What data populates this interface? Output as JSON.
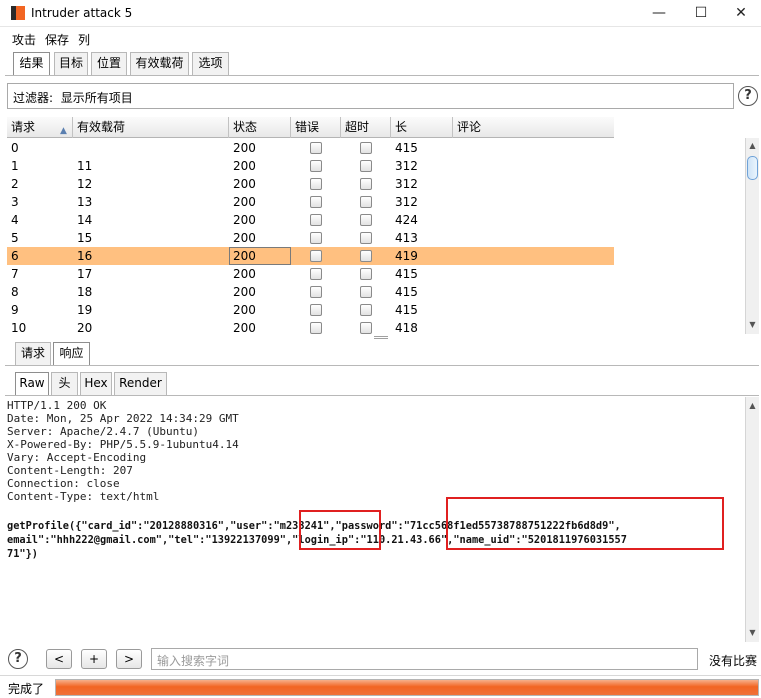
{
  "window": {
    "title": "Intruder attack 5",
    "minimize": "—",
    "maximize": "☐",
    "close": "✕"
  },
  "menu": [
    "攻击",
    "保存",
    "列"
  ],
  "tabs": [
    "结果",
    "目标",
    "位置",
    "有效载荷",
    "选项"
  ],
  "filter": {
    "label": "过滤器:",
    "value": "显示所有项目"
  },
  "help": "?",
  "table": {
    "columns": [
      "请求",
      "有效载荷",
      "状态",
      "错误",
      "超时",
      "长",
      "评论"
    ],
    "sort_indicator": "▲",
    "rows": [
      {
        "request": "0",
        "payload": "",
        "status": "200",
        "error": false,
        "timeout": false,
        "length": "415",
        "comment": ""
      },
      {
        "request": "1",
        "payload": "11",
        "status": "200",
        "error": false,
        "timeout": false,
        "length": "312",
        "comment": ""
      },
      {
        "request": "2",
        "payload": "12",
        "status": "200",
        "error": false,
        "timeout": false,
        "length": "312",
        "comment": ""
      },
      {
        "request": "3",
        "payload": "13",
        "status": "200",
        "error": false,
        "timeout": false,
        "length": "312",
        "comment": ""
      },
      {
        "request": "4",
        "payload": "14",
        "status": "200",
        "error": false,
        "timeout": false,
        "length": "424",
        "comment": ""
      },
      {
        "request": "5",
        "payload": "15",
        "status": "200",
        "error": false,
        "timeout": false,
        "length": "413",
        "comment": ""
      },
      {
        "request": "6",
        "payload": "16",
        "status": "200",
        "error": false,
        "timeout": false,
        "length": "419",
        "comment": ""
      },
      {
        "request": "7",
        "payload": "17",
        "status": "200",
        "error": false,
        "timeout": false,
        "length": "415",
        "comment": ""
      },
      {
        "request": "8",
        "payload": "18",
        "status": "200",
        "error": false,
        "timeout": false,
        "length": "415",
        "comment": ""
      },
      {
        "request": "9",
        "payload": "19",
        "status": "200",
        "error": false,
        "timeout": false,
        "length": "415",
        "comment": ""
      },
      {
        "request": "10",
        "payload": "20",
        "status": "200",
        "error": false,
        "timeout": false,
        "length": "418",
        "comment": ""
      }
    ],
    "selected_index": 6
  },
  "detail_tabs": [
    "请求",
    "响应"
  ],
  "view_tabs": [
    "Raw",
    "头",
    "Hex",
    "Render"
  ],
  "response": {
    "headers": [
      "HTTP/1.1 200 OK",
      "Date: Mon, 25 Apr 2022 14:34:29 GMT",
      "Server: Apache/2.4.7 (Ubuntu)",
      "X-Powered-By: PHP/5.5.9-1ubuntu4.14",
      "Vary: Accept-Encoding",
      "Content-Length: 207",
      "Connection: close",
      "Content-Type: text/html"
    ],
    "body": [
      "getProfile({\"card_id\":\"20128880316\",\"user\":\"m233241\",\"password\":\"71cc568f1ed55738788751222fb6d8d9\",",
      "email\":\"hhh222@gmail.com\",\"tel\":\"13922137099\",\"login_ip\":\"110.21.43.66\",\"name_uid\":\"5201811976031557",
      "71\"})"
    ]
  },
  "bottom": {
    "help": "?",
    "prev": "<",
    "add": "+",
    "next": ">",
    "search_placeholder": "输入搜索字词",
    "matches": "没有比赛"
  },
  "status": {
    "text": "完成了",
    "progress": 1.0
  },
  "colors": {
    "selection": "#ffc080",
    "progress": "#f26522",
    "highlight": "#e02020"
  }
}
